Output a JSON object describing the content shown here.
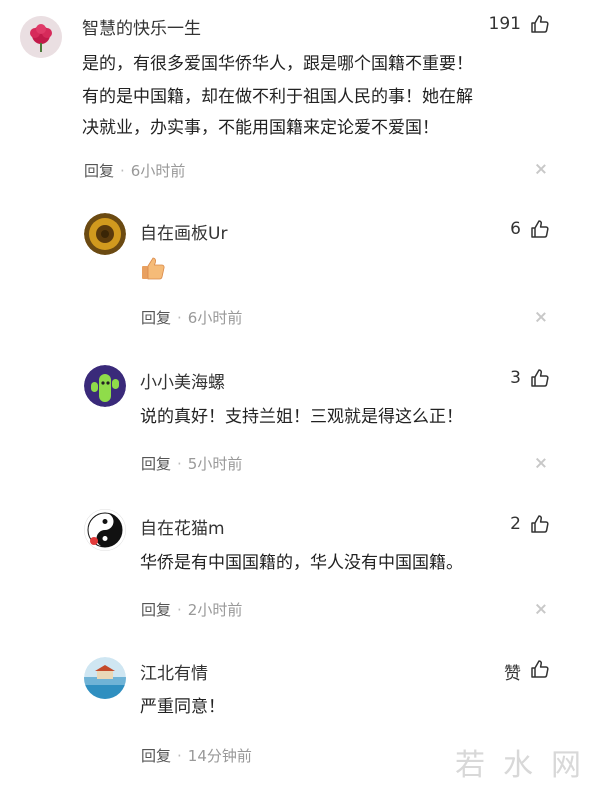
{
  "comments": [
    {
      "name": "智慧的快乐一生",
      "likes": "191",
      "text_lines": [
        "是的，有很多爱国华侨华人，跟是哪个国籍不重要！",
        "有的是中国籍，却在做不利于祖国人民的事！她在解",
        "决就业，办实事，不能用国籍来定论爱不爱国！"
      ],
      "reply_label": "回复",
      "separator": "·",
      "time": "6小时前"
    },
    {
      "name": "自在画板Ur",
      "likes": "6",
      "emoji": "thumbs-up-emoji",
      "reply_label": "回复",
      "separator": "·",
      "time": "6小时前"
    },
    {
      "name": "小小美海螺",
      "likes": "3",
      "text": "说的真好！支持兰姐！三观就是得这么正！",
      "reply_label": "回复",
      "separator": "·",
      "time": "5小时前"
    },
    {
      "name": "自在花猫m",
      "likes": "2",
      "text": "华侨是有中国国籍的，华人没有中国国籍。",
      "reply_label": "回复",
      "separator": "·",
      "time": "2小时前"
    },
    {
      "name": "江北有情",
      "likes": "赞",
      "text": "严重同意！",
      "reply_label": "回复",
      "separator": "·",
      "time": "14分钟前"
    }
  ],
  "watermark": "若水网",
  "colors": {
    "text": "#222222",
    "meta": "#555555",
    "time": "#999999",
    "divider_icon": "#c8c8c8"
  },
  "icons": {
    "like": "thumbs-up-outline-icon",
    "close": "close-icon"
  }
}
